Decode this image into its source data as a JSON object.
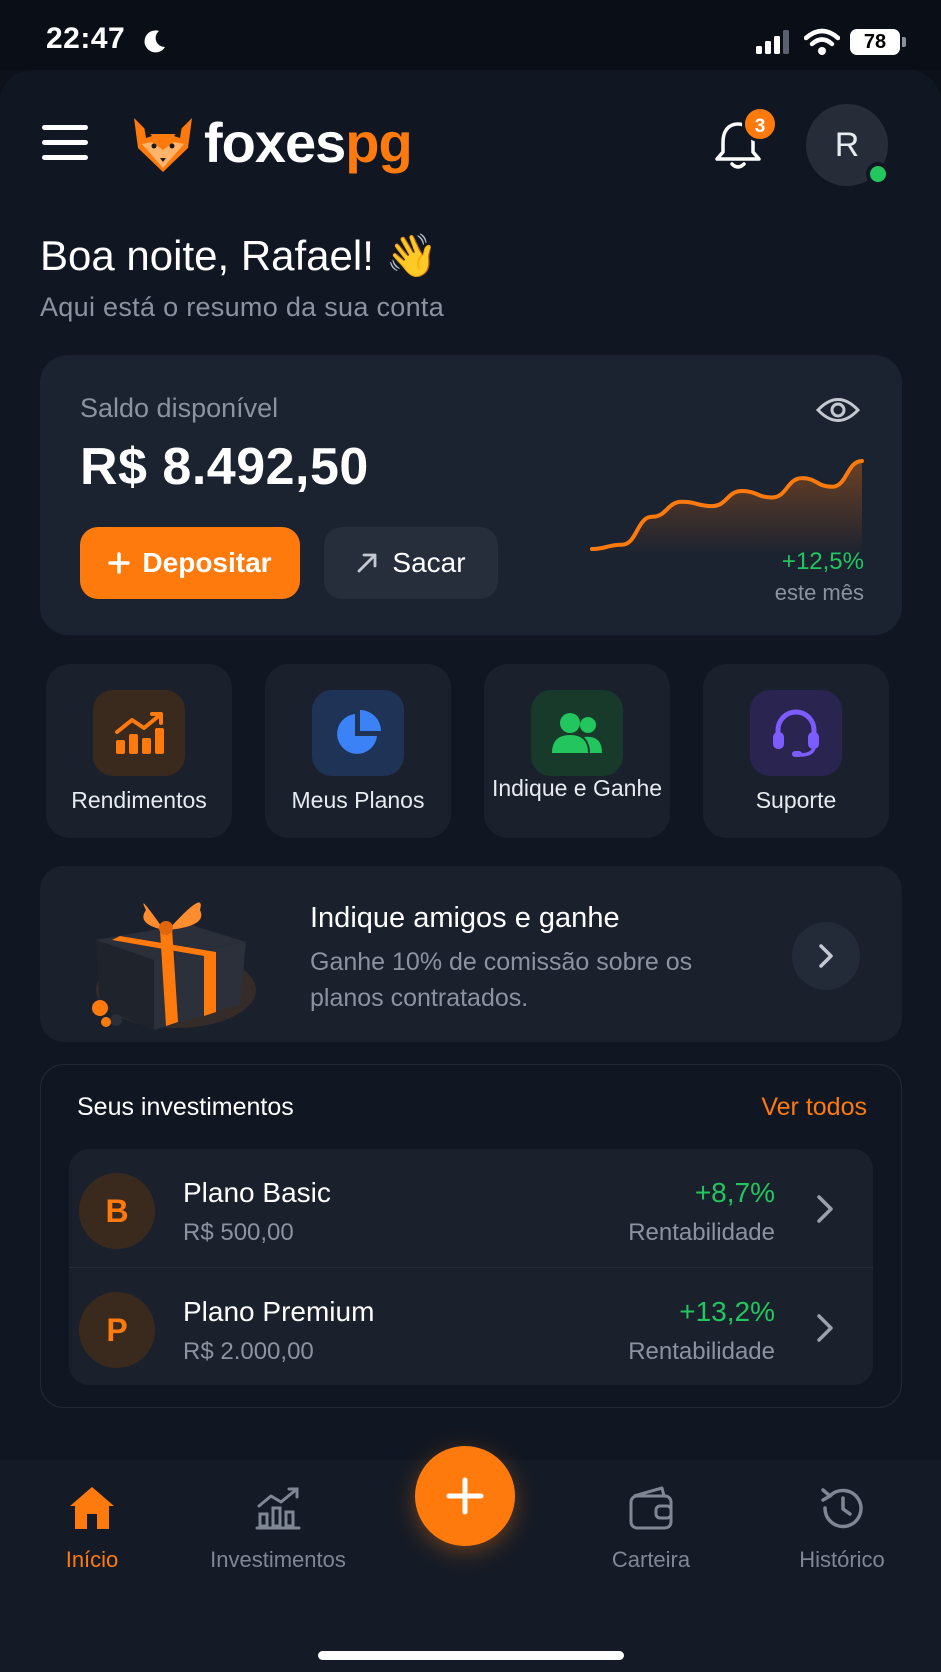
{
  "status_bar": {
    "time": "22:47",
    "battery": "78"
  },
  "header": {
    "brand_part1": "foxes",
    "brand_part2": "pg",
    "notification_count": "3",
    "avatar_initial": "R"
  },
  "greeting": {
    "title": "Boa noite, Rafael! 👋",
    "subtitle": "Aqui está o resumo da sua conta"
  },
  "balance": {
    "label": "Saldo disponível",
    "value": "R$ 8.492,50",
    "deposit_label": "Depositar",
    "withdraw_label": "Sacar",
    "growth": "+12,5%",
    "growth_note": "este mês",
    "sparkline": [
      18,
      22,
      48,
      62,
      58,
      72,
      66,
      84,
      76,
      100
    ]
  },
  "quick_actions": [
    {
      "label": "Rendimentos",
      "icon": "chart-growth-icon",
      "color": "#ff7a0d"
    },
    {
      "label": "Meus Planos",
      "icon": "pie-chart-icon",
      "color": "#3b82f6"
    },
    {
      "label": "Indique e Ganhe",
      "icon": "users-icon",
      "color": "#22c55e"
    },
    {
      "label": "Suporte",
      "icon": "headset-icon",
      "color": "#7c5cff"
    }
  ],
  "promo": {
    "title": "Indique amigos e ganhe",
    "description": "Ganhe 10% de comissão sobre os planos contratados."
  },
  "investments": {
    "title": "Seus investimentos",
    "see_all": "Ver todos",
    "items": [
      {
        "initial": "B",
        "name": "Plano Basic",
        "amount": "R$ 500,00",
        "return": "+8,7%",
        "return_label": "Rentabilidade"
      },
      {
        "initial": "P",
        "name": "Plano Premium",
        "amount": "R$ 2.000,00",
        "return": "+13,2%",
        "return_label": "Rentabilidade"
      }
    ]
  },
  "nav": {
    "items": [
      {
        "label": "Início",
        "icon": "home-icon"
      },
      {
        "label": "Investimentos",
        "icon": "chart-icon"
      },
      {
        "label": "Carteira",
        "icon": "wallet-icon"
      },
      {
        "label": "Histórico",
        "icon": "history-icon"
      }
    ],
    "active": "Início"
  },
  "colors": {
    "accent": "#ff7a0d",
    "positive": "#22c55e",
    "background": "#111722",
    "card": "#1b2230"
  }
}
